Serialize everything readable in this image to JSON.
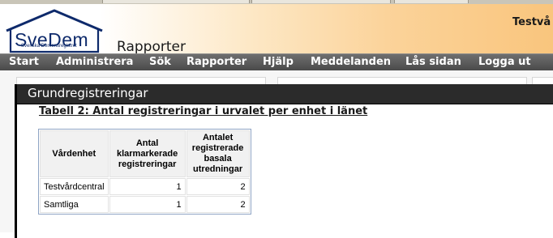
{
  "header": {
    "logo_text": "SveDem",
    "logo_subtitle": "Svenska Demensregistret",
    "app_title": "Rapporter",
    "user": "Testvå"
  },
  "nav": {
    "items": [
      "Start",
      "Administrera",
      "Sök",
      "Rapporter",
      "Hjälp",
      "Meddelanden",
      "Lås sidan",
      "Logga ut"
    ]
  },
  "colors": {
    "nav_bg": "#575757",
    "panel_header_bg": "#2b2b2b",
    "logo_blue": "#0e2a6b",
    "header_gradient_end": "#f9c57d"
  },
  "panel": {
    "title": "Grundregistreringar",
    "table_caption": "Tabell 2: Antal registreringar i urvalet per enhet i länet"
  },
  "table": {
    "headers": [
      "Vårdenhet",
      "Antal klarmarkerade registreringar",
      "Antalet registrerade basala utredningar"
    ],
    "rows": [
      [
        "Testvårdcentral",
        "1",
        "2"
      ],
      [
        "Samtliga",
        "1",
        "2"
      ]
    ]
  }
}
